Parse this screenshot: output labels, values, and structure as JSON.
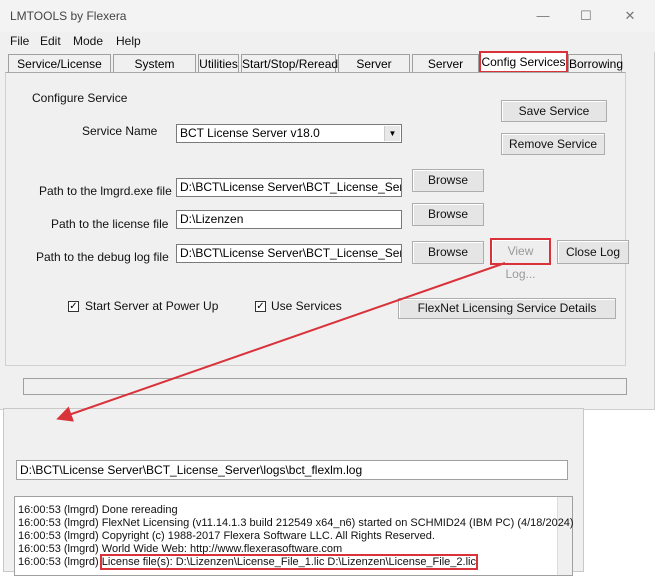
{
  "window": {
    "title": "LMTOOLS by Flexera",
    "minimize_icon": "—",
    "maximize_icon": "☐",
    "close_icon": "✕"
  },
  "menu": [
    "File",
    "Edit",
    "Mode",
    "Help"
  ],
  "tabs": [
    "Service/License File",
    "System Settings",
    "Utilities",
    "Start/Stop/Reread",
    "Server Status",
    "Server Diags",
    "Config Services",
    "Borrowing"
  ],
  "selected_tab": "Config Services",
  "config": {
    "group_label": "Configure Service",
    "service_name_label": "Service Name",
    "service_name_value": "BCT License Server v18.0",
    "lmgrd_label": "Path to the lmgrd.exe file",
    "lmgrd_value": "D:\\BCT\\License Server\\BCT_License_Server\\bct",
    "license_label": "Path to the license file",
    "license_value": "D:\\Lizenzen",
    "debug_label": "Path to the debug log file",
    "debug_value": "D:\\BCT\\License Server\\BCT_License_Server\\logs",
    "browse": "Browse",
    "view_log": "View Log...",
    "close_log": "Close Log",
    "save_service": "Save Service",
    "remove_service": "Remove Service",
    "start_at_powerup": "Start Server at Power Up",
    "use_services": "Use Services",
    "flexnet_details": "FlexNet Licensing Service Details",
    "check_mark": "✓"
  },
  "log_viewer": {
    "path": "D:\\BCT\\License Server\\BCT_License_Server\\logs\\bct_flexlm.log",
    "lines": [
      "16:00:53 (lmgrd) Done rereading",
      "16:00:53 (lmgrd) FlexNet Licensing (v11.14.1.3 build 212549 x64_n6) started on SCHMID24 (IBM PC) (4/18/2024)",
      "16:00:53 (lmgrd) Copyright (c) 1988-2017 Flexera Software LLC. All Rights Reserved.",
      "16:00:53 (lmgrd) World Wide Web:  http://www.flexerasoftware.com"
    ],
    "license_prefix": "16:00:53 (lmgrd) ",
    "license_line": "License file(s): D:\\Lizenzen\\License_File_1.lic D:\\Lizenzen\\License_File_2.lic"
  },
  "colors": {
    "highlight": "#d9323a",
    "window_bg": "#f0f0f0"
  }
}
